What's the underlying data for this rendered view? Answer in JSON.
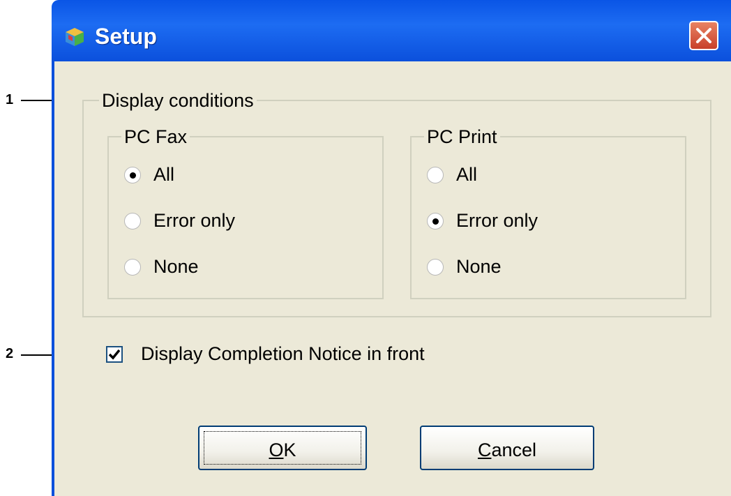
{
  "callouts": [
    {
      "number": "1"
    },
    {
      "number": "2"
    }
  ],
  "window": {
    "title": "Setup",
    "close_icon": "close-x-icon",
    "app_icon": "setup-cube-icon"
  },
  "display_conditions": {
    "label": "Display conditions",
    "pc_fax": {
      "label": "PC Fax",
      "options": [
        "All",
        "Error only",
        "None"
      ],
      "selected": "All"
    },
    "pc_print": {
      "label": "PC Print",
      "options": [
        "All",
        "Error only",
        "None"
      ],
      "selected": "Error only"
    }
  },
  "completion_notice": {
    "label": "Display Completion Notice in front",
    "checked": true
  },
  "buttons": {
    "ok_mnemonic": "O",
    "ok_rest": "K",
    "cancel_mnemonic": "C",
    "cancel_rest": "ancel"
  },
  "colors": {
    "titlebar": "#0b50dc",
    "close_button": "#d9553a",
    "dialog_background": "#ece9d8"
  }
}
